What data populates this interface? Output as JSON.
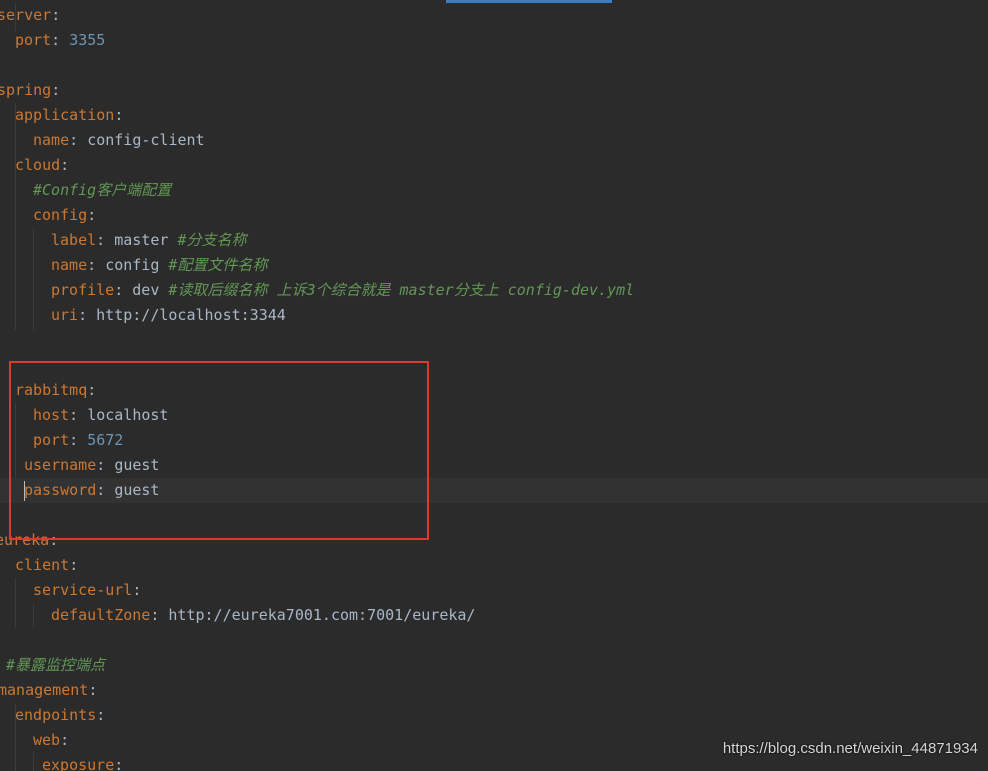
{
  "lines": [
    {
      "key": "server",
      "sep": ":",
      "value": "",
      "vtype": "",
      "comment": ""
    },
    {
      "key": "port",
      "sep": ": ",
      "value": "3355",
      "vtype": "n",
      "comment": ""
    },
    {
      "key": "",
      "sep": "",
      "value": "",
      "vtype": "",
      "comment": ""
    },
    {
      "key": "spring",
      "sep": ":",
      "value": "",
      "vtype": "",
      "comment": ""
    },
    {
      "key": "application",
      "sep": ":",
      "value": "",
      "vtype": "",
      "comment": ""
    },
    {
      "key": "name",
      "sep": ": ",
      "value": "config-client",
      "vtype": "s",
      "comment": ""
    },
    {
      "key": "cloud",
      "sep": ":",
      "value": "",
      "vtype": "",
      "comment": ""
    },
    {
      "key": "",
      "sep": "",
      "value": "",
      "vtype": "",
      "comment": "#Config客户端配置"
    },
    {
      "key": "config",
      "sep": ":",
      "value": "",
      "vtype": "",
      "comment": ""
    },
    {
      "key": "label",
      "sep": ": ",
      "value": "master",
      "vtype": "s",
      "comment": "#分支名称"
    },
    {
      "key": "name",
      "sep": ": ",
      "value": "config",
      "vtype": "s",
      "comment": "#配置文件名称"
    },
    {
      "key": "profile",
      "sep": ": ",
      "value": "dev",
      "vtype": "s",
      "comment": "#读取后缀名称 上诉3个综合就是 master分支上 config-dev.yml"
    },
    {
      "key": "uri",
      "sep": ": ",
      "value": "http://localhost:3344",
      "vtype": "s",
      "comment": ""
    },
    {
      "key": "",
      "sep": "",
      "value": "",
      "vtype": "",
      "comment": ""
    },
    {
      "key": "",
      "sep": "",
      "value": "",
      "vtype": "",
      "comment": ""
    },
    {
      "key": "rabbitmq",
      "sep": ":",
      "value": "",
      "vtype": "",
      "comment": ""
    },
    {
      "key": "host",
      "sep": ": ",
      "value": "localhost",
      "vtype": "s",
      "comment": ""
    },
    {
      "key": "port",
      "sep": ": ",
      "value": "5672",
      "vtype": "n",
      "comment": ""
    },
    {
      "key": "username",
      "sep": ": ",
      "value": "guest",
      "vtype": "s",
      "comment": ""
    },
    {
      "key": "password",
      "sep": ": ",
      "value": "guest",
      "vtype": "s",
      "comment": ""
    },
    {
      "key": "",
      "sep": "",
      "value": "",
      "vtype": "",
      "comment": ""
    },
    {
      "key": "eureka",
      "sep": ":",
      "value": "",
      "vtype": "",
      "comment": ""
    },
    {
      "key": "client",
      "sep": ":",
      "value": "",
      "vtype": "",
      "comment": ""
    },
    {
      "key": "service-url",
      "sep": ":",
      "value": "",
      "vtype": "",
      "comment": ""
    },
    {
      "key": "defaultZone",
      "sep": ": ",
      "value": "http://eureka7001.com:7001/eureka/",
      "vtype": "s",
      "comment": ""
    },
    {
      "key": "",
      "sep": "",
      "value": "",
      "vtype": "",
      "comment": ""
    },
    {
      "key": "",
      "sep": "",
      "value": "",
      "vtype": "",
      "comment": "#暴露监控端点"
    },
    {
      "key": "management",
      "sep": ":",
      "value": "",
      "vtype": "",
      "comment": ""
    },
    {
      "key": "endpoints",
      "sep": ":",
      "value": "",
      "vtype": "",
      "comment": ""
    },
    {
      "key": "web",
      "sep": ":",
      "value": "",
      "vtype": "",
      "comment": ""
    },
    {
      "key": "exposure",
      "sep": ":",
      "value": "",
      "vtype": "",
      "comment": ""
    }
  ],
  "watermark": "https://blog.csdn.net/weixin_44871934",
  "colors": {
    "background": "#2b2b2b",
    "key": "#cc7832",
    "string": "#a9b7c6",
    "number": "#6897bb",
    "comment": "#629755",
    "annotation_box": "#e0382e",
    "scroll_indicator": "#3d7ec2"
  }
}
